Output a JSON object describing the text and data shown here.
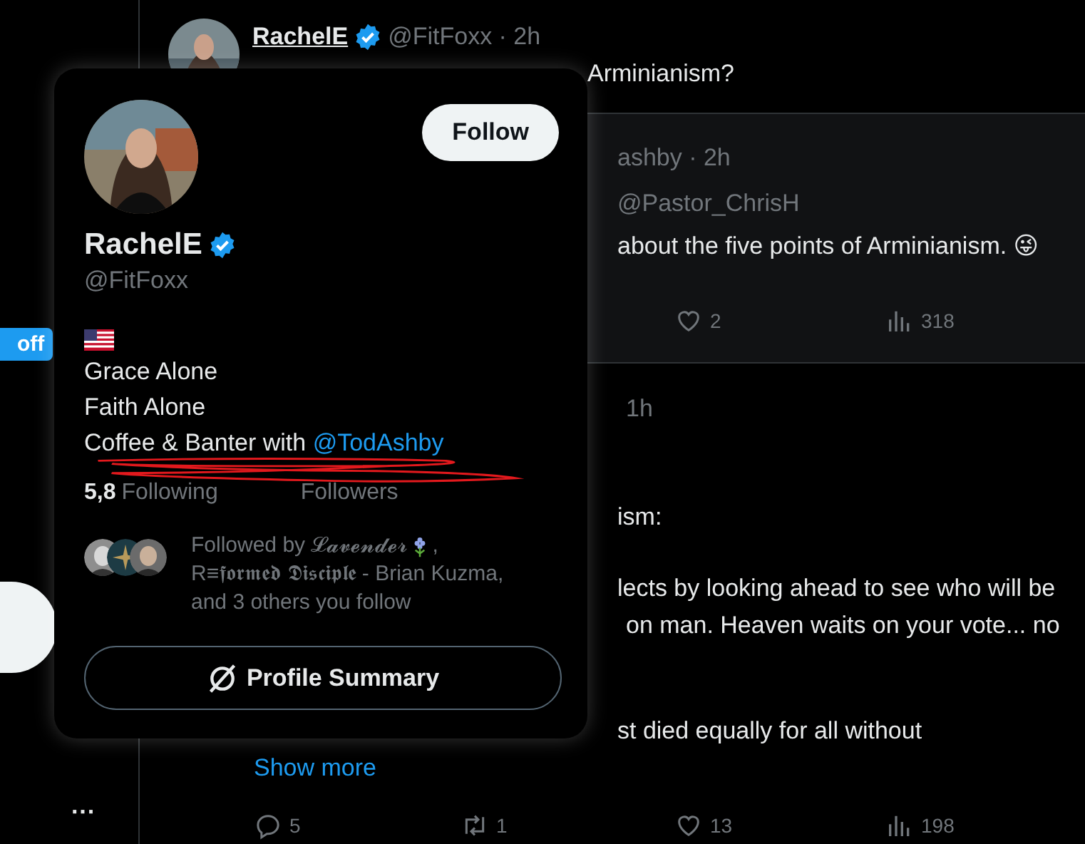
{
  "left_rail": {
    "badge": "off",
    "more": "···"
  },
  "tweets": [
    {
      "author": "RachelE",
      "verified": true,
      "meta": "@FitFoxx · 2h",
      "text": "Arminianism?",
      "highlighted": false
    },
    {
      "header": "ashby · 2h",
      "mention": "@Pastor_ChrisH",
      "text": "about the five points of Arminianism. 😜",
      "highlighted": true,
      "actions": [
        {
          "kind": "like",
          "count": "2"
        },
        {
          "kind": "views",
          "count": "318"
        }
      ]
    },
    {
      "header": "1h",
      "highlighted": false,
      "paragraphs": [
        [
          "ism:"
        ],
        [
          "lects by looking ahead to see who will be",
          "on man. Heaven waits on your vote... no"
        ],
        [
          "st died equally for all without"
        ]
      ],
      "show_more": "Show more",
      "actions": [
        {
          "kind": "reply",
          "count": "5"
        },
        {
          "kind": "retweet",
          "count": "1"
        },
        {
          "kind": "like",
          "count": "13"
        },
        {
          "kind": "views",
          "count": "198"
        }
      ]
    }
  ],
  "hover_card": {
    "name": "RachelE",
    "verified": true,
    "handle": "@FitFoxx",
    "follow_button": "Follow",
    "bio": [
      {
        "text": "Grace Alone"
      },
      {
        "text": "Faith Alone"
      },
      {
        "text": "Coffee & Banter with ",
        "link": "@TodAshby"
      }
    ],
    "stats": [
      {
        "count": "5,8",
        "label": "Following"
      },
      {
        "label": "Followers"
      }
    ],
    "followed_by": {
      "before_icon": "Followed by 𝓛𝓪𝓿𝓮𝓷𝓭𝓮𝓻",
      "after_icon": ",",
      "more_lines": [
        "R≡𝖋𝖔𝖗𝖒𝖊𝖉 𝕯𝖎𝖘𝖈𝖎𝖕𝖑𝖊 - Brian Kuzma,",
        "and 3 others you follow"
      ]
    },
    "summary_button": "Profile Summary"
  }
}
